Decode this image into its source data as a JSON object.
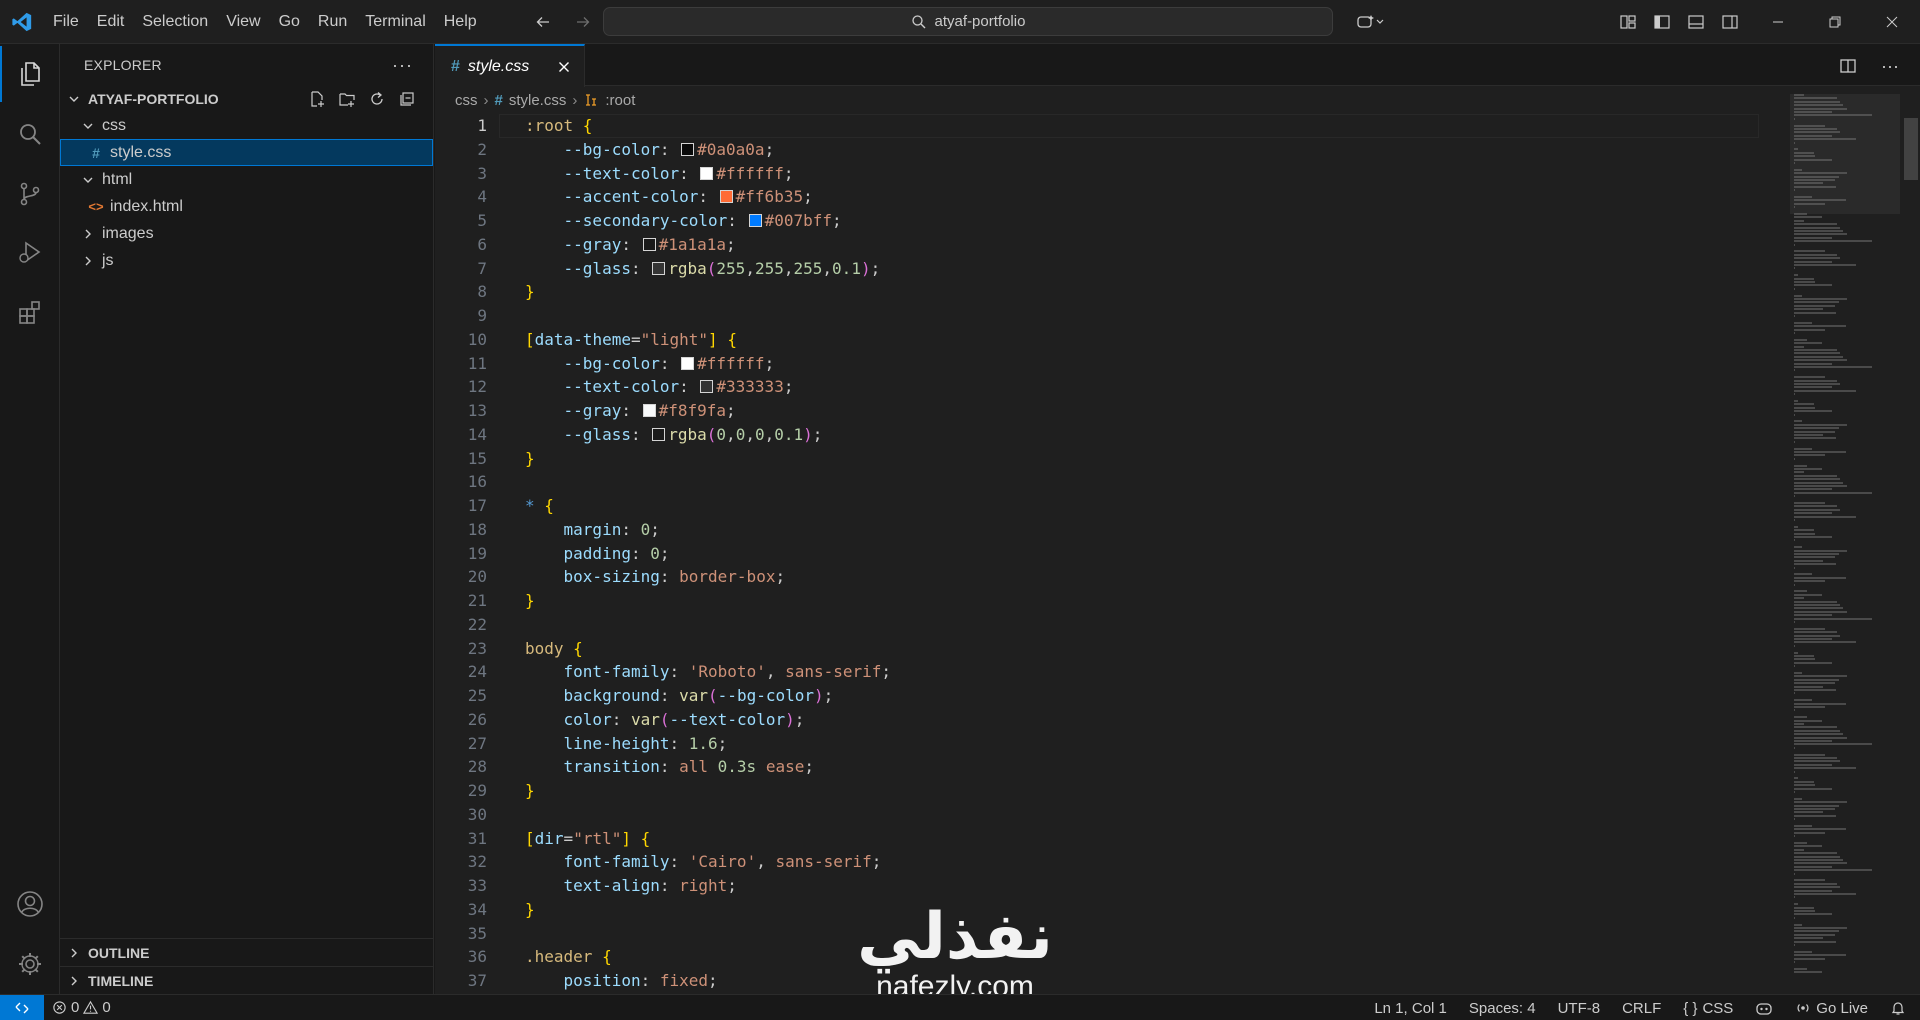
{
  "window": {
    "menu": [
      "File",
      "Edit",
      "Selection",
      "View",
      "Go",
      "Run",
      "Terminal",
      "Help"
    ],
    "search_text": "atyaf-portfolio"
  },
  "colors": {
    "accent": "#0078d4",
    "background": "#1f1f1f",
    "sidebar": "#181818",
    "selection": "#04395e"
  },
  "sidebar": {
    "title": "EXPLORER",
    "folder": "ATYAF-PORTFOLIO",
    "tree": [
      {
        "label": "css",
        "type": "folder",
        "expanded": true,
        "depth": 1
      },
      {
        "label": "style.css",
        "type": "css",
        "depth": 2,
        "selected": true
      },
      {
        "label": "html",
        "type": "folder",
        "expanded": true,
        "depth": 1
      },
      {
        "label": "index.html",
        "type": "html",
        "depth": 2
      },
      {
        "label": "images",
        "type": "folder",
        "expanded": false,
        "depth": 1
      },
      {
        "label": "js",
        "type": "folder",
        "expanded": false,
        "depth": 1
      }
    ],
    "outline_label": "OUTLINE",
    "timeline_label": "TIMELINE"
  },
  "editor": {
    "tab_label": "style.css",
    "breadcrumb": {
      "folder": "css",
      "file": "style.css",
      "symbol": ":root"
    },
    "lines": [
      [
        [
          "sel",
          ":root "
        ],
        [
          "b1",
          "{"
        ]
      ],
      [
        [
          "",
          "    "
        ],
        [
          "prop",
          "--bg-color"
        ],
        [
          "punc",
          ": "
        ],
        [
          "swatch",
          "#0a0a0a"
        ],
        [
          "val",
          "#0a0a0a"
        ],
        [
          "punc",
          ";"
        ]
      ],
      [
        [
          "",
          "    "
        ],
        [
          "prop",
          "--text-color"
        ],
        [
          "punc",
          ": "
        ],
        [
          "swatch",
          "#ffffff"
        ],
        [
          "val",
          "#ffffff"
        ],
        [
          "punc",
          ";"
        ]
      ],
      [
        [
          "",
          "    "
        ],
        [
          "prop",
          "--accent-color"
        ],
        [
          "punc",
          ": "
        ],
        [
          "swatch",
          "#ff6b35"
        ],
        [
          "val",
          "#ff6b35"
        ],
        [
          "punc",
          ";"
        ]
      ],
      [
        [
          "",
          "    "
        ],
        [
          "prop",
          "--secondary-color"
        ],
        [
          "punc",
          ": "
        ],
        [
          "swatch",
          "#007bff"
        ],
        [
          "val",
          "#007bff"
        ],
        [
          "punc",
          ";"
        ]
      ],
      [
        [
          "",
          "    "
        ],
        [
          "prop",
          "--gray"
        ],
        [
          "punc",
          ": "
        ],
        [
          "swatch",
          "#1a1a1a"
        ],
        [
          "val",
          "#1a1a1a"
        ],
        [
          "punc",
          ";"
        ]
      ],
      [
        [
          "",
          "    "
        ],
        [
          "prop",
          "--glass"
        ],
        [
          "punc",
          ": "
        ],
        [
          "swatch",
          "rgba(255,255,255,0.1)"
        ],
        [
          "fn",
          "rgba"
        ],
        [
          "b2",
          "("
        ],
        [
          "num",
          "255"
        ],
        [
          "punc",
          ","
        ],
        [
          "num",
          "255"
        ],
        [
          "punc",
          ","
        ],
        [
          "num",
          "255"
        ],
        [
          "punc",
          ","
        ],
        [
          "num",
          "0.1"
        ],
        [
          "b2",
          ")"
        ],
        [
          "punc",
          ";"
        ]
      ],
      [
        [
          "b1",
          "}"
        ]
      ],
      [],
      [
        [
          "b1",
          "["
        ],
        [
          "prop",
          "data-theme"
        ],
        [
          "punc",
          "="
        ],
        [
          "val",
          "\"light\""
        ],
        [
          "b1",
          "]"
        ],
        [
          "punc",
          " "
        ],
        [
          "b1",
          "{"
        ]
      ],
      [
        [
          "",
          "    "
        ],
        [
          "prop",
          "--bg-color"
        ],
        [
          "punc",
          ": "
        ],
        [
          "swatch",
          "#ffffff"
        ],
        [
          "val",
          "#ffffff"
        ],
        [
          "punc",
          ";"
        ]
      ],
      [
        [
          "",
          "    "
        ],
        [
          "prop",
          "--text-color"
        ],
        [
          "punc",
          ": "
        ],
        [
          "swatch",
          "#333333"
        ],
        [
          "val",
          "#333333"
        ],
        [
          "punc",
          ";"
        ]
      ],
      [
        [
          "",
          "    "
        ],
        [
          "prop",
          "--gray"
        ],
        [
          "punc",
          ": "
        ],
        [
          "swatch",
          "#f8f9fa"
        ],
        [
          "val",
          "#f8f9fa"
        ],
        [
          "punc",
          ";"
        ]
      ],
      [
        [
          "",
          "    "
        ],
        [
          "prop",
          "--glass"
        ],
        [
          "punc",
          ": "
        ],
        [
          "swatch",
          "rgba(0,0,0,0.1)"
        ],
        [
          "fn",
          "rgba"
        ],
        [
          "b2",
          "("
        ],
        [
          "num",
          "0"
        ],
        [
          "punc",
          ","
        ],
        [
          "num",
          "0"
        ],
        [
          "punc",
          ","
        ],
        [
          "num",
          "0"
        ],
        [
          "punc",
          ","
        ],
        [
          "num",
          "0.1"
        ],
        [
          "b2",
          ")"
        ],
        [
          "punc",
          ";"
        ]
      ],
      [
        [
          "b1",
          "}"
        ]
      ],
      [],
      [
        [
          "kw",
          "* "
        ],
        [
          "b1",
          "{"
        ]
      ],
      [
        [
          "",
          "    "
        ],
        [
          "prop",
          "margin"
        ],
        [
          "punc",
          ": "
        ],
        [
          "num",
          "0"
        ],
        [
          "punc",
          ";"
        ]
      ],
      [
        [
          "",
          "    "
        ],
        [
          "prop",
          "padding"
        ],
        [
          "punc",
          ": "
        ],
        [
          "num",
          "0"
        ],
        [
          "punc",
          ";"
        ]
      ],
      [
        [
          "",
          "    "
        ],
        [
          "prop",
          "box-sizing"
        ],
        [
          "punc",
          ": "
        ],
        [
          "val",
          "border-box"
        ],
        [
          "punc",
          ";"
        ]
      ],
      [
        [
          "b1",
          "}"
        ]
      ],
      [],
      [
        [
          "sel",
          "body "
        ],
        [
          "b1",
          "{"
        ]
      ],
      [
        [
          "",
          "    "
        ],
        [
          "prop",
          "font-family"
        ],
        [
          "punc",
          ": "
        ],
        [
          "val",
          "'Roboto'"
        ],
        [
          "punc",
          ", "
        ],
        [
          "val",
          "sans-serif"
        ],
        [
          "punc",
          ";"
        ]
      ],
      [
        [
          "",
          "    "
        ],
        [
          "prop",
          "background"
        ],
        [
          "punc",
          ": "
        ],
        [
          "fn",
          "var"
        ],
        [
          "b2",
          "("
        ],
        [
          "prop",
          "--bg-color"
        ],
        [
          "b2",
          ")"
        ],
        [
          "punc",
          ";"
        ]
      ],
      [
        [
          "",
          "    "
        ],
        [
          "prop",
          "color"
        ],
        [
          "punc",
          ": "
        ],
        [
          "fn",
          "var"
        ],
        [
          "b2",
          "("
        ],
        [
          "prop",
          "--text-color"
        ],
        [
          "b2",
          ")"
        ],
        [
          "punc",
          ";"
        ]
      ],
      [
        [
          "",
          "    "
        ],
        [
          "prop",
          "line-height"
        ],
        [
          "punc",
          ": "
        ],
        [
          "num",
          "1.6"
        ],
        [
          "punc",
          ";"
        ]
      ],
      [
        [
          "",
          "    "
        ],
        [
          "prop",
          "transition"
        ],
        [
          "punc",
          ": "
        ],
        [
          "val",
          "all "
        ],
        [
          "num",
          "0.3s"
        ],
        [
          "val",
          " ease"
        ],
        [
          "punc",
          ";"
        ]
      ],
      [
        [
          "b1",
          "}"
        ]
      ],
      [],
      [
        [
          "b1",
          "["
        ],
        [
          "prop",
          "dir"
        ],
        [
          "punc",
          "="
        ],
        [
          "val",
          "\"rtl\""
        ],
        [
          "b1",
          "]"
        ],
        [
          "punc",
          " "
        ],
        [
          "b1",
          "{"
        ]
      ],
      [
        [
          "",
          "    "
        ],
        [
          "prop",
          "font-family"
        ],
        [
          "punc",
          ": "
        ],
        [
          "val",
          "'Cairo'"
        ],
        [
          "punc",
          ", "
        ],
        [
          "val",
          "sans-serif"
        ],
        [
          "punc",
          ";"
        ]
      ],
      [
        [
          "",
          "    "
        ],
        [
          "prop",
          "text-align"
        ],
        [
          "punc",
          ": "
        ],
        [
          "val",
          "right"
        ],
        [
          "punc",
          ";"
        ]
      ],
      [
        [
          "b1",
          "}"
        ]
      ],
      [],
      [
        [
          "sel",
          ".header "
        ],
        [
          "b1",
          "{"
        ]
      ],
      [
        [
          "",
          "    "
        ],
        [
          "prop",
          "position"
        ],
        [
          "punc",
          ": "
        ],
        [
          "val",
          "fixed"
        ],
        [
          "punc",
          ";"
        ]
      ]
    ]
  },
  "watermark": {
    "arabic": "نفذلي",
    "latin": "nafezly.com"
  },
  "status": {
    "errors": "0",
    "warnings": "0",
    "cursor": "Ln 1, Col 1",
    "spaces": "Spaces: 4",
    "encoding": "UTF-8",
    "eol": "CRLF",
    "language": "CSS",
    "go_live": "Go Live"
  },
  "icons": [
    "vscode-logo-icon",
    "files-icon",
    "search-icon",
    "source-control-icon",
    "run-debug-icon",
    "extensions-icon",
    "account-icon",
    "gear-icon",
    "bell-icon",
    "copilot-icon"
  ]
}
